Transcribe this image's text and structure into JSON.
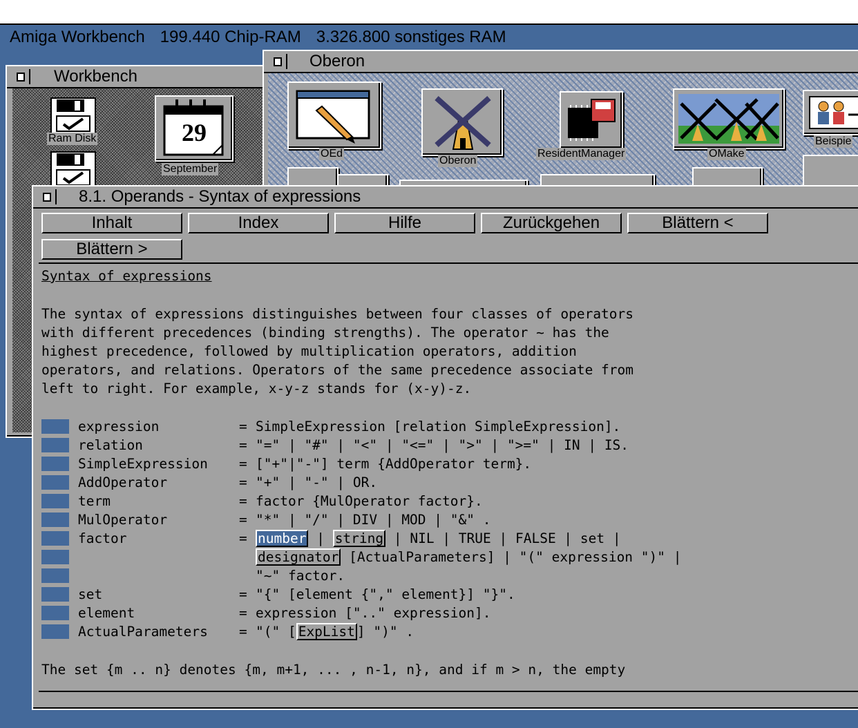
{
  "screen": {
    "title": "Amiga Workbench",
    "chip_ram": "199.440 Chip-RAM",
    "other_ram": "3.326.800 sonstiges RAM"
  },
  "workbench_window": {
    "title": "Workbench",
    "icons": [
      {
        "label": "Ram Disk",
        "icon": "disk-icon"
      },
      {
        "label": "September",
        "icon": "calendar-icon",
        "day": "29"
      },
      {
        "label": "",
        "icon": "disk-icon"
      }
    ]
  },
  "oberon_window": {
    "title": "Oberon",
    "icons": [
      {
        "label": "OEd",
        "icon": "editor-icon"
      },
      {
        "label": "Oberon",
        "icon": "windmill-icon"
      },
      {
        "label": "ResidentManager",
        "icon": "chip-icon"
      },
      {
        "label": "OMake",
        "icon": "windmills-icon"
      },
      {
        "label": "Beispie",
        "icon": "people-icon"
      }
    ]
  },
  "help_window": {
    "title": "8.1. Operands - Syntax of expressions",
    "buttons": {
      "inhalt": "Inhalt",
      "index": "Index",
      "hilfe": "Hilfe",
      "zurueck": "Zurückgehen",
      "prev": "Blättern <",
      "next": "Blättern >"
    },
    "heading": "Syntax of expressions",
    "intro": [
      "The syntax of expressions distinguishes between four classes of operators",
      "with different precedences (binding strengths). The operator ~ has the",
      "highest precedence, followed by multiplication operators, addition",
      "operators, and relations. Operators of the same precedence associate from",
      "left to right. For example, x-y-z stands for (x-y)-z."
    ],
    "grammar": {
      "expression": {
        "name": "expression",
        "eq": "=",
        "rule": "SimpleExpression [relation SimpleExpression]."
      },
      "relation": {
        "name": "relation",
        "eq": "=",
        "rule": "\"=\" | \"#\" | \"<\" | \"<=\" | \">\" | \">=\" | IN | IS."
      },
      "simple": {
        "name": "SimpleExpression",
        "eq": "=",
        "rule": "[\"+\"|\"-\"] term {AddOperator term}."
      },
      "addop": {
        "name": "AddOperator",
        "eq": "=",
        "rule": "\"+\" | \"-\" | OR."
      },
      "term": {
        "name": "term",
        "eq": "=",
        "rule": "factor {MulOperator factor}."
      },
      "mulop": {
        "name": "MulOperator",
        "eq": "=",
        "rule": "\"*\" | \"/\" | DIV | MOD | \"&\" ."
      },
      "factor": {
        "name": "factor",
        "eq": "=",
        "link_number": "number",
        "sep1": " | ",
        "link_string": "string",
        "rest1": " | NIL | TRUE | FALSE | set |",
        "link_designator": "designator",
        "rest2": " [ActualParameters] | \"(\" expression \")\" |",
        "line3": "\"~\" factor."
      },
      "set": {
        "name": "set",
        "eq": "=",
        "rule": "\"{\" [element {\",\" element}] \"}\"."
      },
      "element": {
        "name": "element",
        "eq": "=",
        "rule": "expression [\"..\" expression]."
      },
      "actual": {
        "name": "ActualParameters",
        "eq": "=",
        "pre": "\"(\" [",
        "link": "ExpList",
        "post": "] \")\" ."
      }
    },
    "footer_line": "The set {m .. n} denotes {m, m+1, ... , n-1, n}, and if m > n, the empty"
  },
  "colors": {
    "desktop": "#44699a",
    "window": "#a2a2a2",
    "highlight": "#44699a"
  }
}
